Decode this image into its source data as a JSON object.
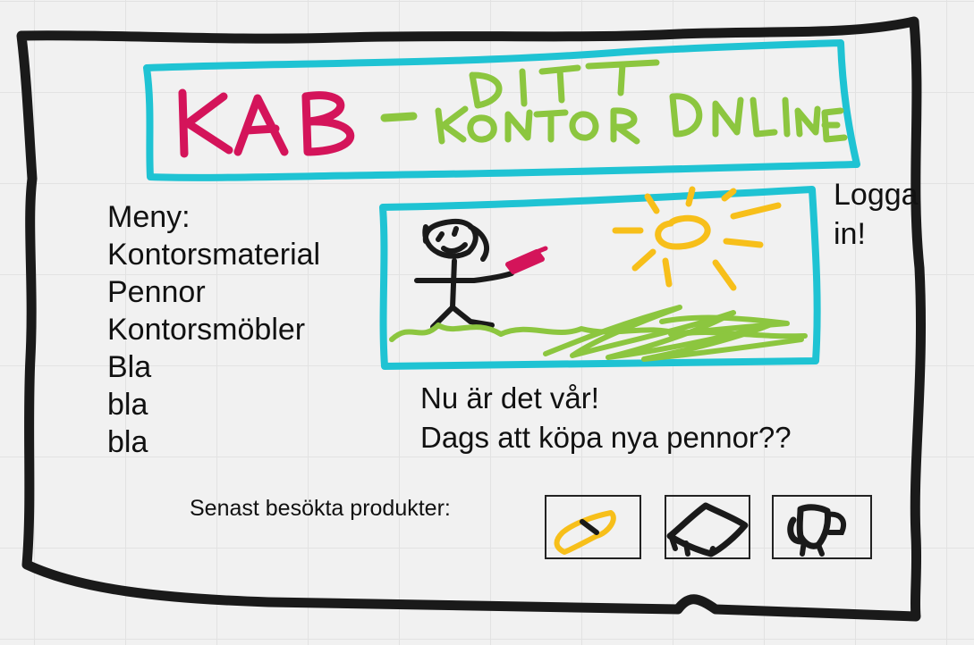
{
  "header": {
    "logo_text": "KAB",
    "dash": "-",
    "tagline_top": "DITT",
    "tagline_bottom": "KONTOR ONLINE",
    "logo_color": "#d4145a",
    "tagline_color": "#8cc63f",
    "frame_color": "#1fc3d3"
  },
  "menu": {
    "heading": "Meny:",
    "items": [
      {
        "label": "Kontorsmaterial"
      },
      {
        "label": "Pennor"
      },
      {
        "label": "Kontorsmöbler"
      },
      {
        "label": "Bla"
      },
      {
        "label": "bla"
      },
      {
        "label": "bla"
      }
    ]
  },
  "login": {
    "label": "Logga in!"
  },
  "hero": {
    "illustration": "stick-figure-with-pen-sun-grass",
    "line1": "Nu är det vår!",
    "line2": "Dags att köpa nya pennor??"
  },
  "recent": {
    "label": "Senast besökta produkter:",
    "products": [
      {
        "icon": "yellow-pen-icon"
      },
      {
        "icon": "desk-icon"
      },
      {
        "icon": "chair-icon"
      }
    ]
  },
  "colors": {
    "outline": "#1a1a1a",
    "sun": "#f7bf1a",
    "grass": "#8cc63f",
    "pen": "#d4145a",
    "frame": "#1fc3d3"
  }
}
